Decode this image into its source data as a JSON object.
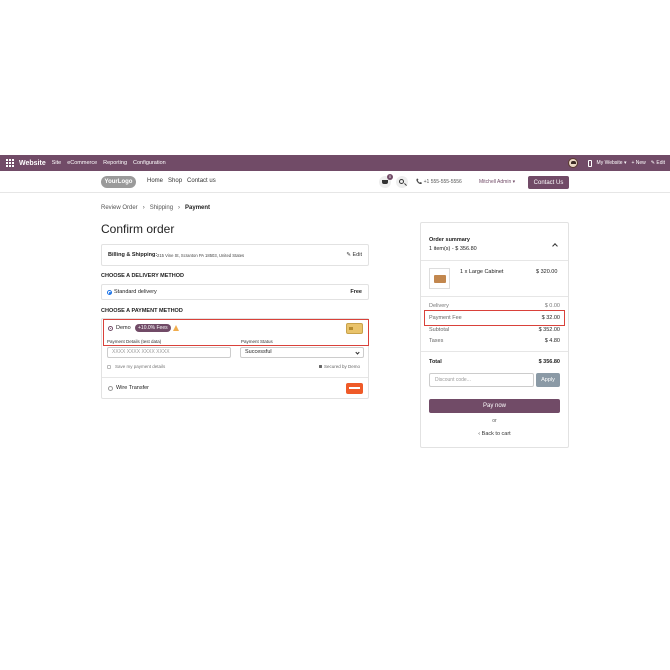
{
  "admin_bar": {
    "brand": "Website",
    "menu": [
      "Site",
      "eCommerce",
      "Reporting",
      "Configuration"
    ],
    "my_website": "My Website ▾",
    "new_label": "+ New",
    "edit_label": "✎ Edit",
    "color": "#714B67"
  },
  "header": {
    "logo_a": "Your",
    "logo_b": "Logo",
    "nav": [
      "Home",
      "Shop",
      "Contact us"
    ],
    "cart_count": "0",
    "phone": "📞  +1 555-555-5556",
    "user": "Mitchell Admin ▾",
    "contact_button": "Contact Us"
  },
  "breadcrumb": {
    "step1": "Review Order",
    "sep": "›",
    "step2": "Shipping",
    "step3": "Payment"
  },
  "page_title": "Confirm order",
  "billing": {
    "label": "Billing & Shipping:",
    "address": "215 Vine St, Scranton PA 18503, United States",
    "edit": "✎ Edit"
  },
  "delivery": {
    "heading": "CHOOSE A DELIVERY METHOD",
    "method": "Standard delivery",
    "price": "Free"
  },
  "payment": {
    "heading": "CHOOSE A PAYMENT METHOD",
    "demo_label": "Demo",
    "fee_badge": "+10.0% Fees",
    "details_label": "Payment Details (test data)",
    "card_placeholder": "XXXX XXXX XXXX XXXX",
    "status_label": "Payment Status",
    "status_value": "Successful",
    "save_label": "Save my payment details",
    "secured": "Secured by Demo",
    "wire_label": "Wire Transfer"
  },
  "summary": {
    "title": "Order summary",
    "sub": "1 item(s) -  $ 356.80",
    "product": "1 x Large Cabinet",
    "product_price": "$ 320.00",
    "delivery_label": "Delivery",
    "delivery_value": "$ 0.00",
    "fee_label": "Payment Fee",
    "fee_value": "$ 32.00",
    "subtotal_label": "Subtotal",
    "subtotal_value": "$ 352.00",
    "taxes_label": "Taxes",
    "taxes_value": "$ 4.80",
    "total_label": "Total",
    "total_value": "$ 356.80",
    "discount_placeholder": "Discount code...",
    "apply": "Apply",
    "pay_now": "Pay now",
    "or": "or",
    "back": "‹  Back to cart"
  }
}
